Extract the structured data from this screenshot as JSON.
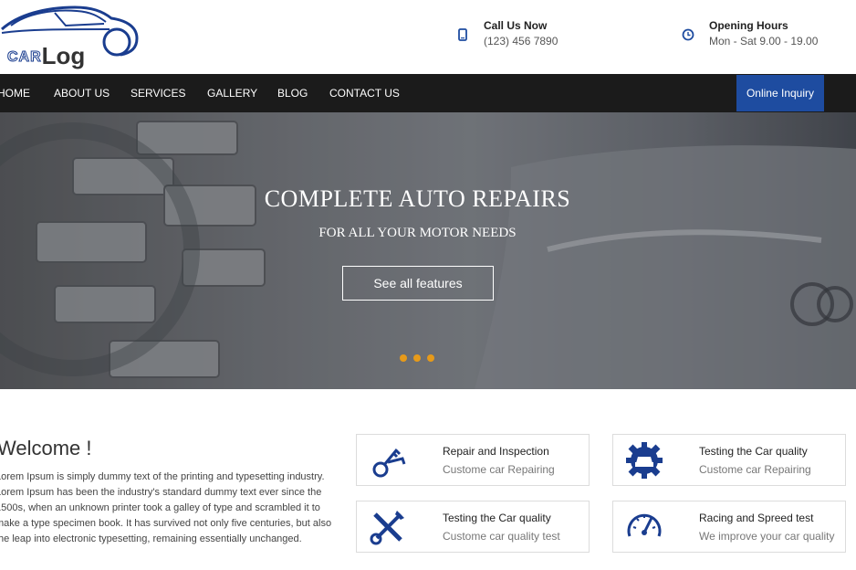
{
  "brand": {
    "logo_car": "CAR",
    "logo_log": "Log"
  },
  "contact": {
    "call_title": "Call Us Now",
    "call_value": "(123) 456 7890",
    "hours_title": "Opening Hours",
    "hours_value": "Mon - Sat 9.00 - 19.00"
  },
  "nav": {
    "items": [
      "HOME",
      "ABOUT US",
      "SERVICES",
      "GALLERY",
      "BLOG",
      "CONTACT US"
    ],
    "inquiry": "Online Inquiry"
  },
  "hero": {
    "title": "COMPLETE AUTO REPAIRS",
    "subtitle": "FOR ALL YOUR MOTOR NEEDS",
    "button": "See all features"
  },
  "welcome": {
    "title": "Welcome !",
    "text": "Lorem Ipsum is simply dummy text of the printing and typesetting industry. Lorem Ipsum has been the industry's standard dummy text ever since the 1500s, when an unknown printer took a galley of type and scrambled it to make a type specimen book. It has survived not only five centuries, but also the leap into electronic typesetting, remaining essentially unchanged."
  },
  "features": [
    {
      "title": "Repair and Inspection",
      "subtitle": "Custome car Repairing",
      "icon": "keys-icon"
    },
    {
      "title": "Testing the Car quality",
      "subtitle": "Custome car Repairing",
      "icon": "gear-car-icon"
    },
    {
      "title": "Testing the Car quality",
      "subtitle": "Custome car quality test",
      "icon": "tools-icon"
    },
    {
      "title": "Racing and Spreed test",
      "subtitle": "We improve your car quality",
      "icon": "speedometer-icon"
    }
  ],
  "colors": {
    "accent": "#1e4ca0",
    "nav_bg": "#1b1b1b",
    "dot": "#e69a1a"
  }
}
